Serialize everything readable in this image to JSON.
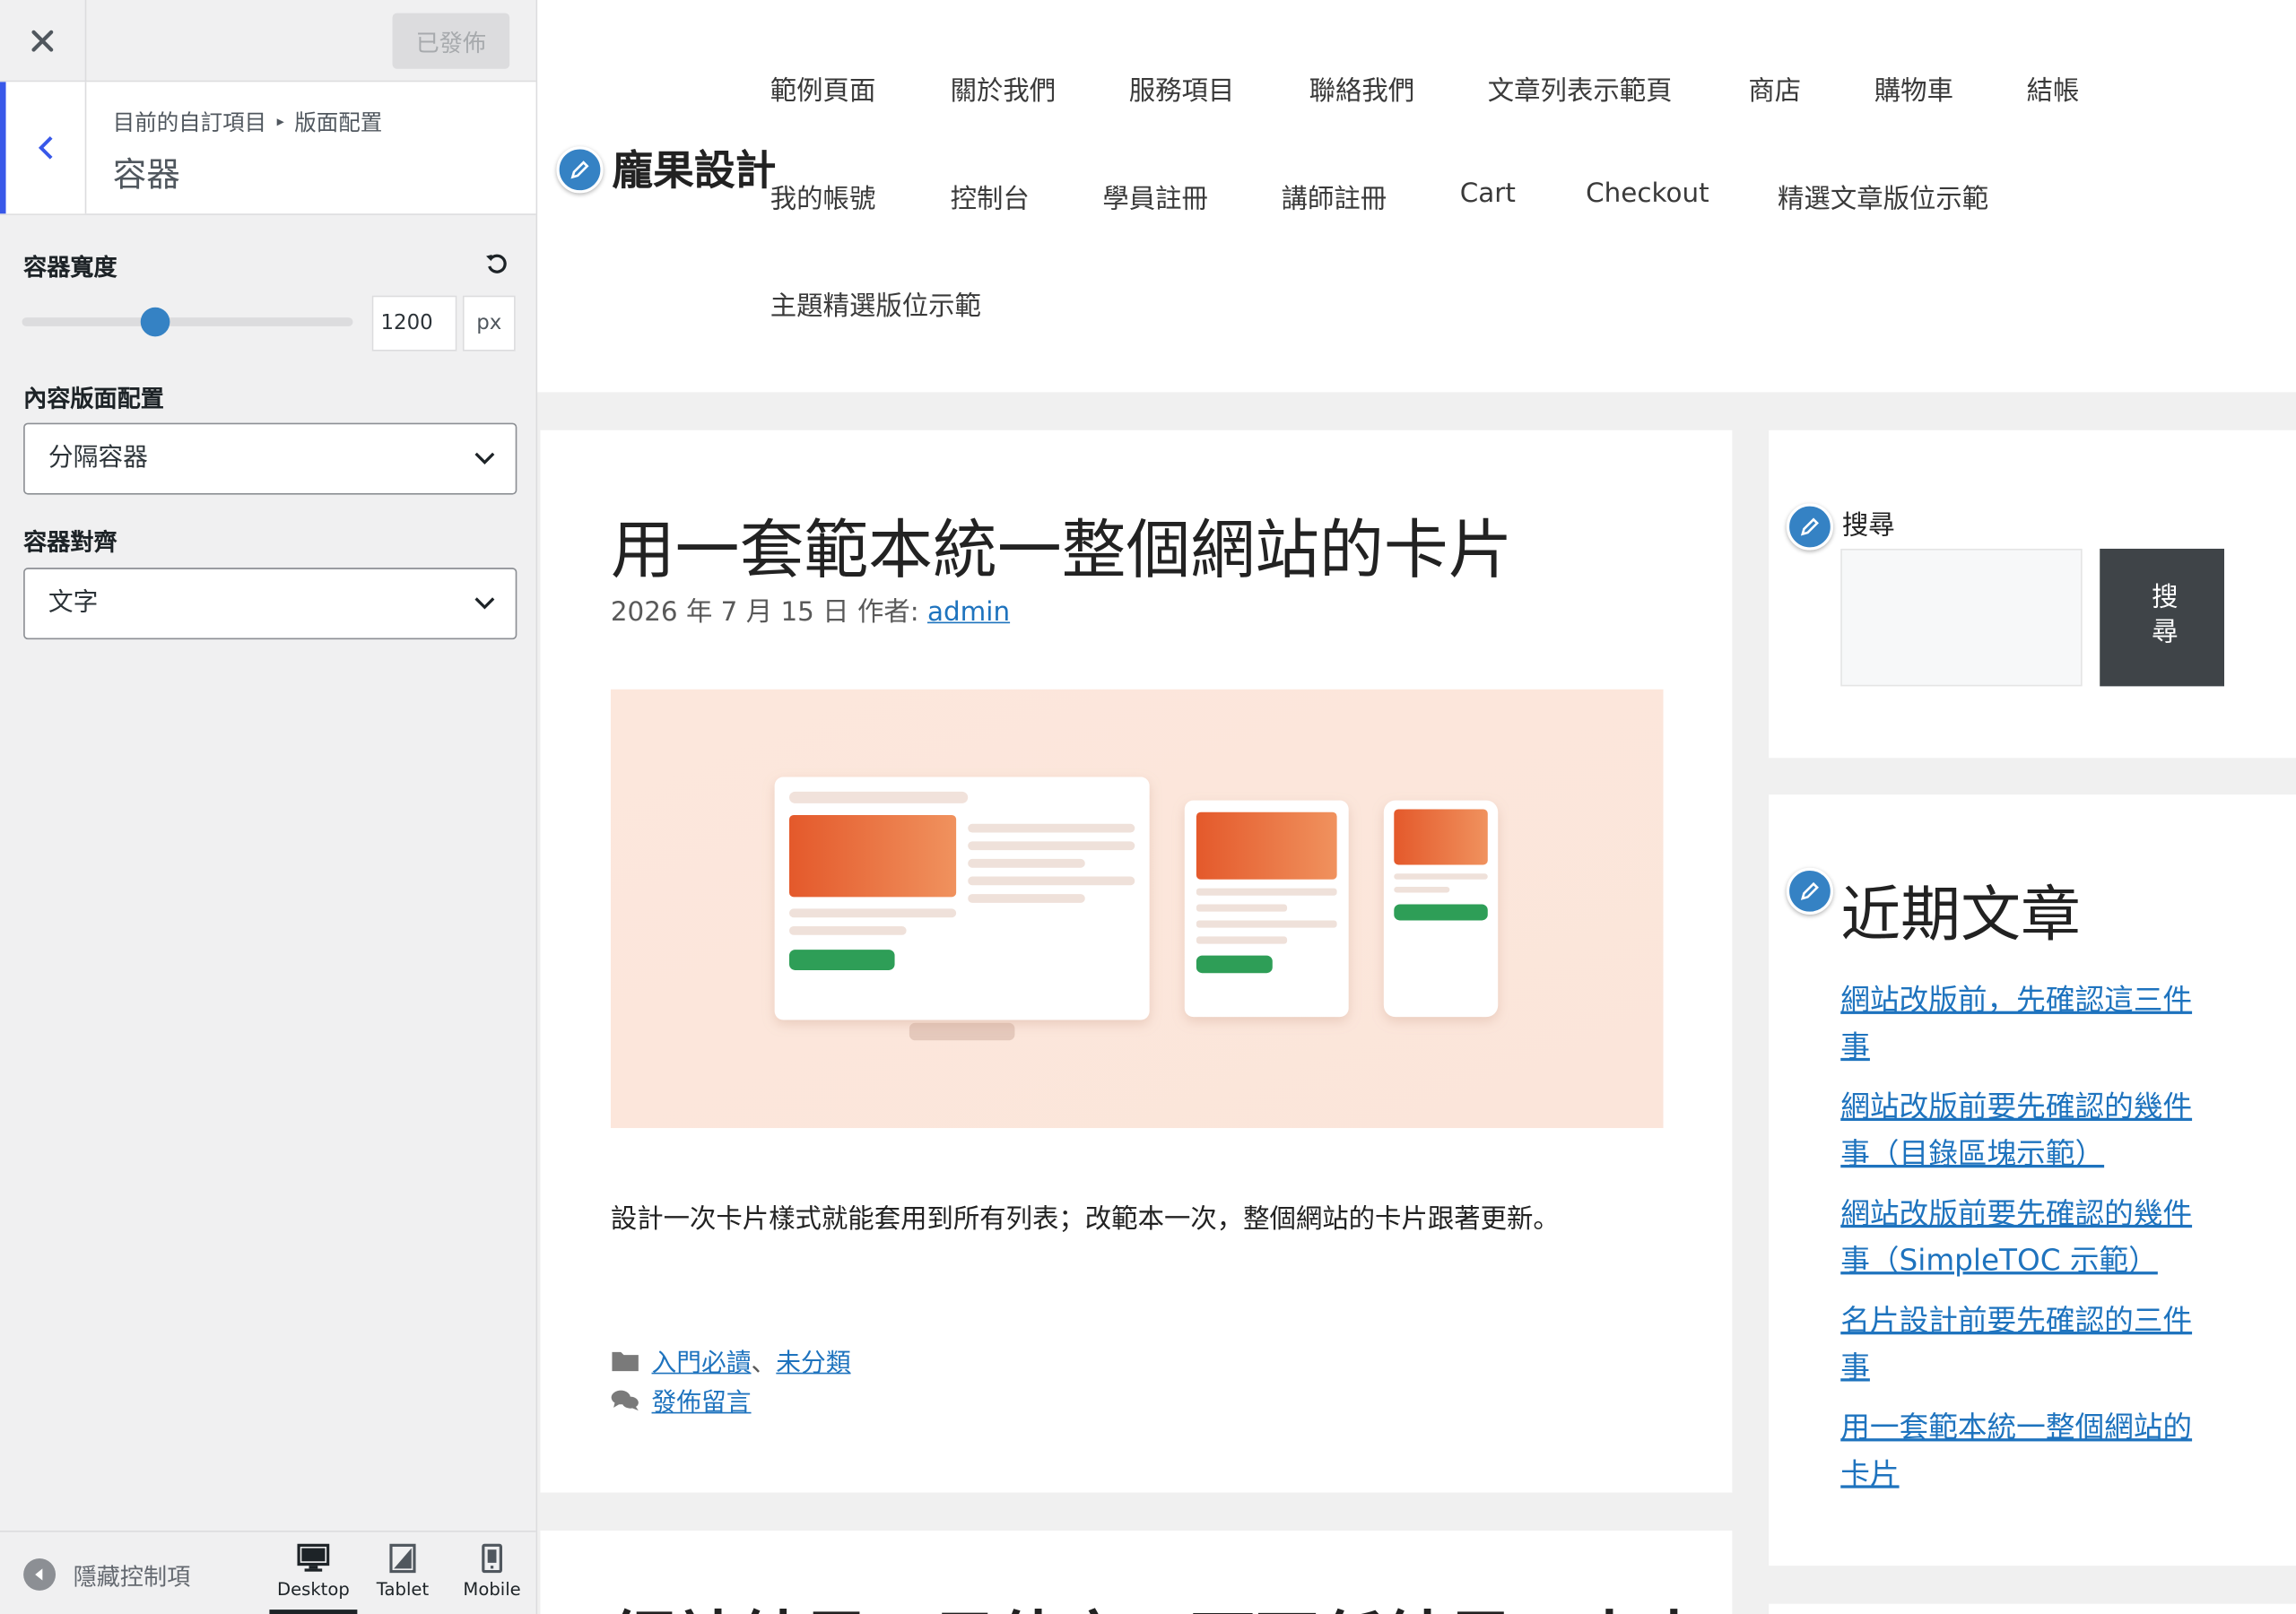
{
  "sidebar": {
    "publish_label": "已發佈",
    "breadcrumb": [
      "目前的自訂項目",
      "版面配置"
    ],
    "section_title": "容器",
    "controls": {
      "container_width_label": "容器寬度",
      "container_width_value": "1200",
      "container_width_unit": "px",
      "content_layout_label": "內容版面配置",
      "content_layout_value": "分隔容器",
      "container_alignment_label": "容器對齊",
      "container_alignment_value": "文字"
    },
    "footer": {
      "hide_controls_label": "隱藏控制項",
      "devices": [
        "Desktop",
        "Tablet",
        "Mobile"
      ],
      "active_device": "Desktop"
    }
  },
  "site": {
    "title": "龐果設計",
    "nav": [
      "範例頁面",
      "關於我們",
      "服務項目",
      "聯絡我們",
      "文章列表示範頁",
      "商店",
      "購物車",
      "結帳",
      "我的帳號",
      "控制台",
      "學員註冊",
      "講師註冊",
      "Cart",
      "Checkout",
      "精選文章版位示範",
      "主題精選版位示範"
    ]
  },
  "post": {
    "title": "用一套範本統一整個網站的卡片",
    "date": "2026 年 7 月 15 日",
    "author_prefix": "作者:",
    "author": "admin",
    "excerpt": "設計一次卡片樣式就能套用到所有列表；改範本一次，整個網站的卡片跟著更新。",
    "categories": [
      "入門必讀",
      "未分類"
    ],
    "category_separator": "、",
    "comment_link": "發佈留言"
  },
  "next_post": {
    "title": "網站結果一目估方，可不任結果一十十一手機"
  },
  "widgets": {
    "search": {
      "title": "搜尋",
      "button_label": "搜尋"
    },
    "recent": {
      "title": "近期文章",
      "items": [
        "網站改版前，先確認這三件事",
        "網站改版前要先確認的幾件事（目錄區塊示範）",
        "網站改版前要先確認的幾件事（SimpleTOC 示範）",
        "名片設計前要先確認的三件事",
        "用一套範本統一整個網站的卡片"
      ]
    }
  },
  "colors": {
    "accent": "#3582c4",
    "admin_blue": "#3858e9",
    "link": "#1e73be",
    "search_button": "#3f4448"
  }
}
